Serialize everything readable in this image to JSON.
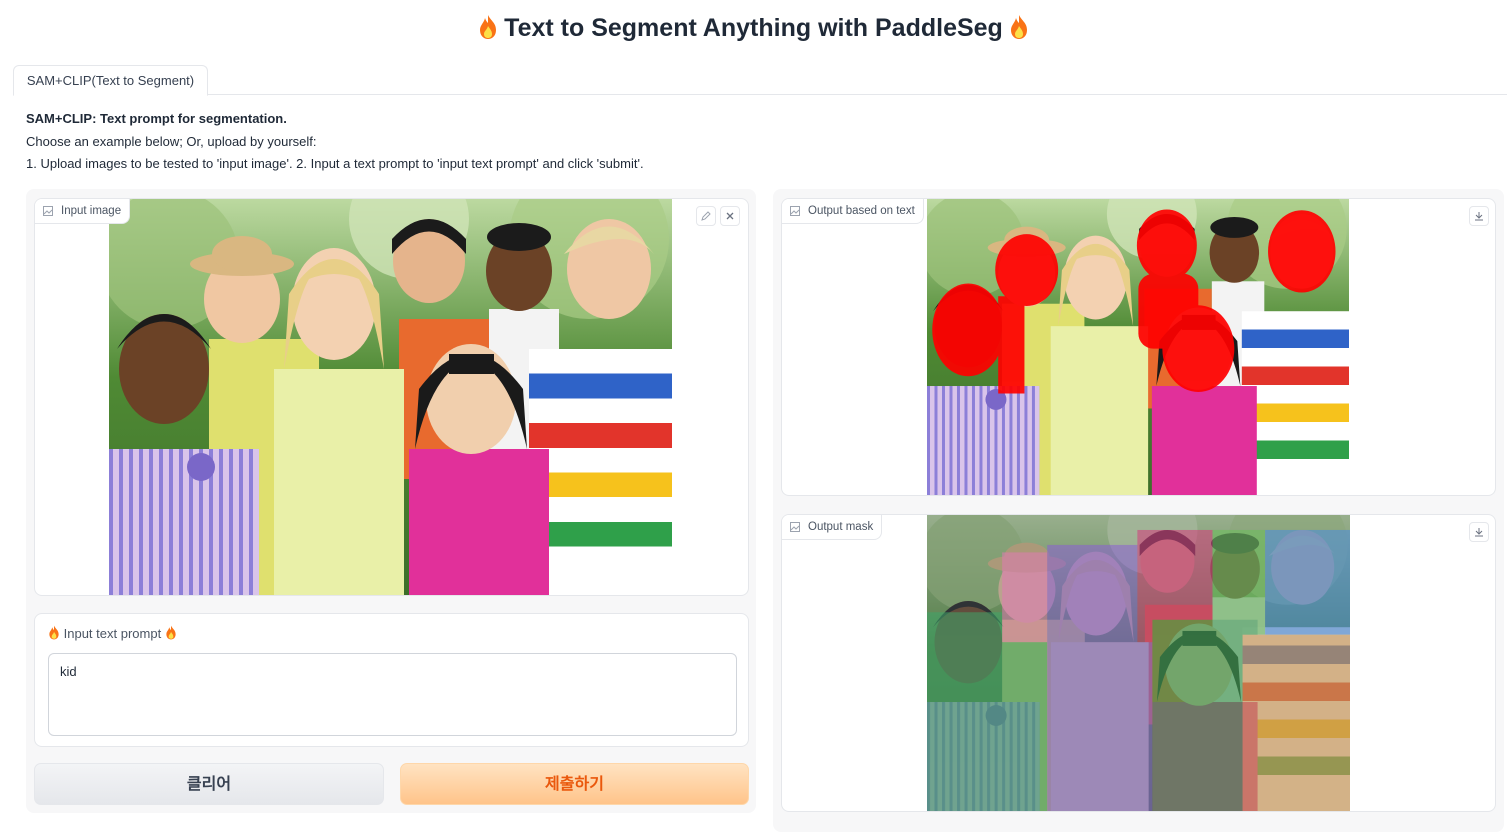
{
  "title": "Text to Segment Anything with PaddleSeg",
  "title_icon": "fire-icon",
  "tabs": [
    {
      "label": "SAM+CLIP(Text to Segment)",
      "active": true
    }
  ],
  "description": {
    "heading": "SAM+CLIP: Text prompt for segmentation.",
    "line1": "Choose an example below; Or, upload by yourself:",
    "line2": "1. Upload images to be tested to 'input image'. 2. Input a text prompt to 'input text prompt' and click 'submit'."
  },
  "input_image": {
    "label": "Input image",
    "icons": [
      "edit-icon",
      "close-icon"
    ]
  },
  "prompt": {
    "label": "Input text prompt",
    "value": "kid"
  },
  "buttons": {
    "clear": "클리어",
    "submit": "제출하기"
  },
  "output_text": {
    "label": "Output based on text",
    "icon": "download-icon"
  },
  "output_mask": {
    "label": "Output mask",
    "icon": "download-icon"
  },
  "colors": {
    "accent": "#ea580c",
    "mask_red": "#ff0000",
    "submit_bg": "#ffc48a"
  }
}
